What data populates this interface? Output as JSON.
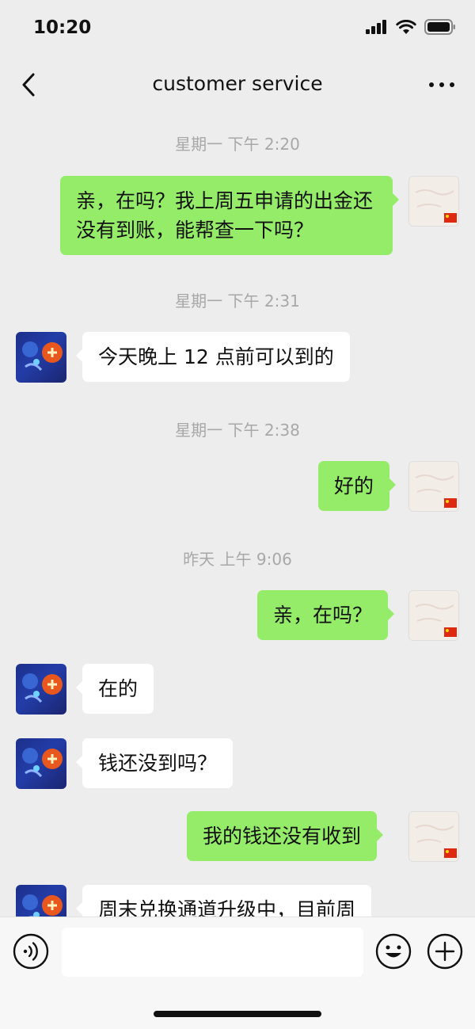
{
  "status_bar": {
    "time": "10:20"
  },
  "header": {
    "title": "customer service"
  },
  "messages": [
    {
      "type": "time",
      "text": "星期一 下午 2:20"
    },
    {
      "type": "out",
      "text": "亲，在吗？我上周五申请的出金还没有到账，能帮查一下吗？"
    },
    {
      "type": "time",
      "text": "星期一 下午 2:31"
    },
    {
      "type": "in",
      "text": "今天晚上 12 点前可以到的"
    },
    {
      "type": "time",
      "text": "星期一 下午 2:38"
    },
    {
      "type": "out",
      "text": "好的"
    },
    {
      "type": "time",
      "text": "昨天 上午 9:06"
    },
    {
      "type": "out",
      "text": "亲，在吗？"
    },
    {
      "type": "in",
      "text": "在的"
    },
    {
      "type": "in",
      "text": "钱还没到吗？"
    },
    {
      "type": "out",
      "text": "我的钱还没有收到"
    },
    {
      "type": "in",
      "text": "周末兑换通道升级中，目前周"
    }
  ],
  "input_bar": {
    "value": ""
  },
  "icons": {
    "back": "chevron-left-icon",
    "more": "more-dots-icon",
    "voice": "voice-icon",
    "emoji": "emoji-icon",
    "plus": "plus-icon"
  },
  "colors": {
    "out_bubble": "#95ec69",
    "in_bubble": "#ffffff",
    "background": "#ededed"
  }
}
